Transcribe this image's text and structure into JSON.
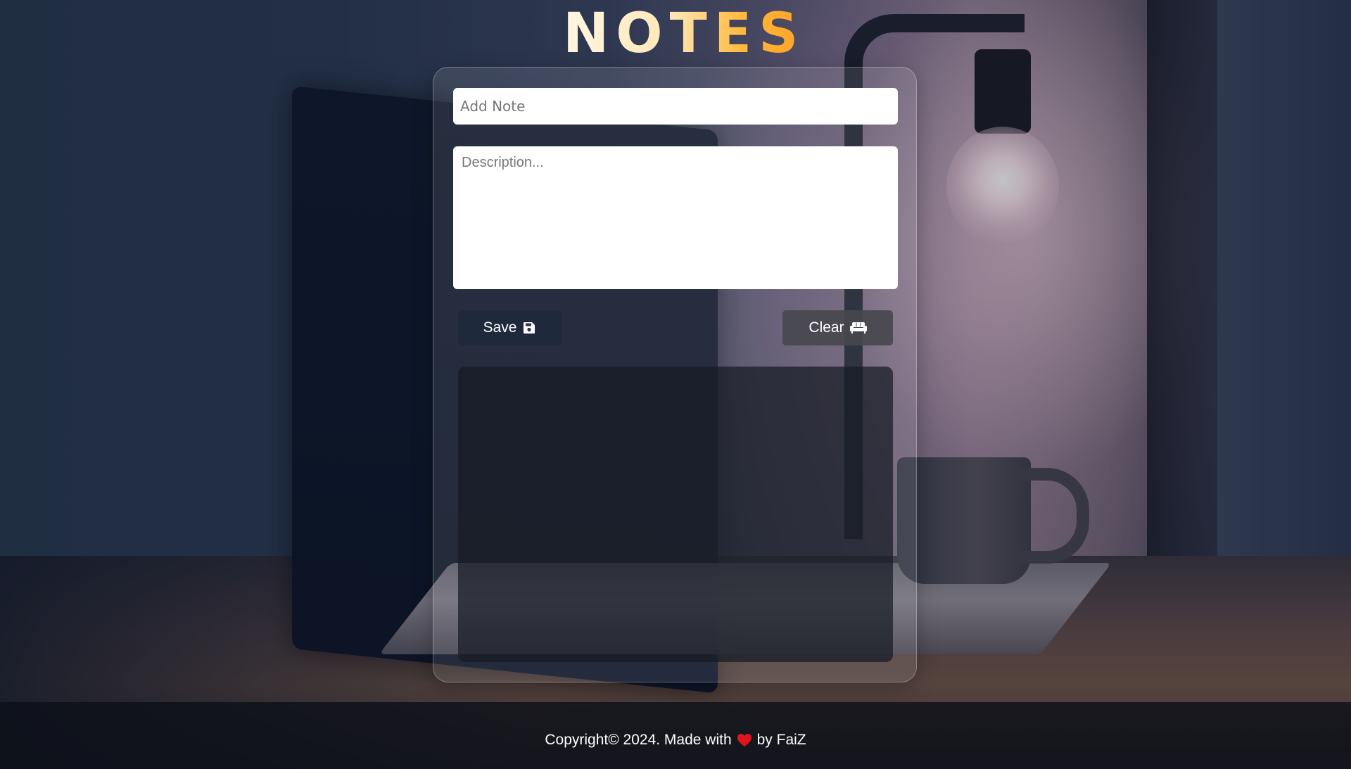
{
  "app": {
    "title": "NOTES"
  },
  "form": {
    "title_placeholder": "Add Note",
    "title_value": "",
    "description_placeholder": "Description...",
    "description_value": ""
  },
  "actions": {
    "save_label": "Save",
    "save_icon": "floppy-disk-icon",
    "clear_label": "Clear",
    "clear_icon": "couch-icon"
  },
  "notes": [],
  "footer": {
    "copyright_text": "Copyright© 2024. Made with",
    "heart_icon": "heart-icon",
    "author_text": "by FaiZ"
  },
  "colors": {
    "title_gradient_start": "#fff6e0",
    "title_gradient_end": "#ffa226",
    "heart": "#e0141e",
    "button_text": "#ffffff",
    "footer_text": "#ffffff"
  }
}
